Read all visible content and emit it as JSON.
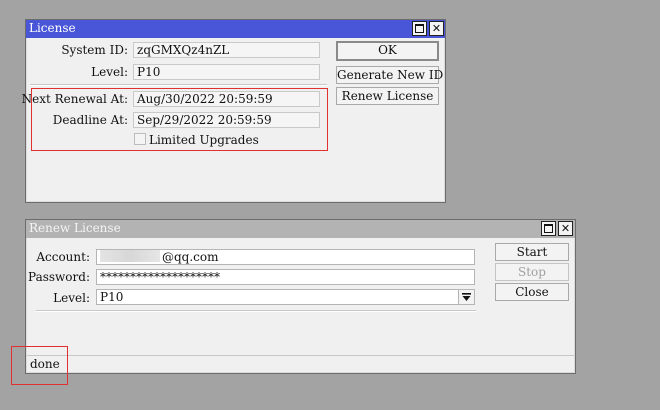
{
  "license_window": {
    "title": "License",
    "system_id_label": "System ID:",
    "system_id_value": "zqGMXQz4nZL",
    "level_label": "Level:",
    "level_value": "P10",
    "next_renewal_label": "Next Renewal At:",
    "next_renewal_value": "Aug/30/2022 20:59:59",
    "deadline_label": "Deadline At:",
    "deadline_value": "Sep/29/2022 20:59:59",
    "limited_upgrades_label": "Limited Upgrades",
    "ok_button": "OK",
    "generate_button": "Generate New ID",
    "renew_button": "Renew License"
  },
  "renew_window": {
    "title": "Renew License",
    "account_label": "Account:",
    "account_value": "@qq.com",
    "password_label": "Password:",
    "password_value": "********************",
    "level_label": "Level:",
    "level_value": "P10",
    "start_button": "Start",
    "stop_button": "Stop",
    "close_button": "Close",
    "status": "done"
  },
  "icons": {
    "maximize": "maximize-icon",
    "close": "close-icon",
    "dropdown": "dropdown-arrow-icon"
  },
  "colors": {
    "active_title": "#4a56d8",
    "inactive_title": "#b3b3b3",
    "highlight": "#e0302f",
    "desktop": "#a3a3a3"
  }
}
